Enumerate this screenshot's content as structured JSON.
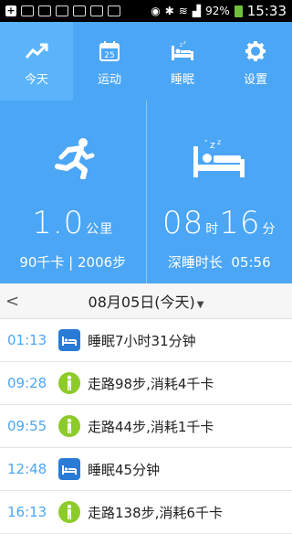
{
  "status": {
    "battery": "92%",
    "time": "15:33"
  },
  "tabs": [
    {
      "label": "今天",
      "icon": "trend-icon"
    },
    {
      "label": "运动",
      "icon": "calendar-icon",
      "calendar_day": "25"
    },
    {
      "label": "睡眠",
      "icon": "bed-icon"
    },
    {
      "label": "设置",
      "icon": "gear-icon"
    }
  ],
  "activity": {
    "value": "1.0",
    "unit": "公里",
    "summary": "90千卡 | 2006步"
  },
  "sleep": {
    "hours": "08",
    "hours_unit": "时",
    "minutes": "16",
    "minutes_unit": "分",
    "deep_label": "深睡时长",
    "deep_value": "05:56"
  },
  "datebar": {
    "back": "<",
    "date": "08月05日(今天)"
  },
  "records": [
    {
      "time": "01:13",
      "type": "sleep",
      "text": "睡眠7小时31分钟"
    },
    {
      "time": "09:28",
      "type": "walk",
      "text": "走路98步,消耗4千卡"
    },
    {
      "time": "09:55",
      "type": "walk",
      "text": "走路44步,消耗1千卡"
    },
    {
      "time": "12:48",
      "type": "sleep",
      "text": "睡眠45分钟"
    },
    {
      "time": "16:13",
      "type": "walk",
      "text": "走路138步,消耗6千卡"
    }
  ]
}
